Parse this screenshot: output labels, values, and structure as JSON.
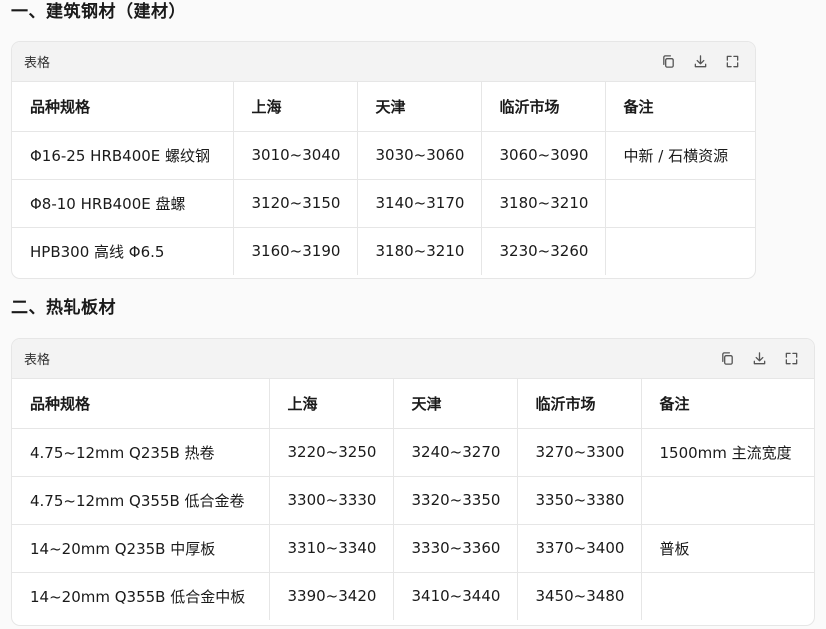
{
  "sections": [
    {
      "title": "一、建筑钢材（建材）",
      "card_label": "表格",
      "headers": [
        "品种规格",
        "上海",
        "天津",
        "临沂市场",
        "备注"
      ],
      "rows": [
        [
          "Φ16-25 HRB400E 螺纹钢",
          "3010~3040",
          "3030~3060",
          "3060~3090",
          "中新 / 石横资源"
        ],
        [
          "Φ8-10 HRB400E 盘螺",
          "3120~3150",
          "3140~3170",
          "3180~3210",
          ""
        ],
        [
          "HPB300 高线 Φ6.5",
          "3160~3190",
          "3180~3210",
          "3230~3260",
          ""
        ]
      ]
    },
    {
      "title": "二、热轧板材",
      "card_label": "表格",
      "headers": [
        "品种规格",
        "上海",
        "天津",
        "临沂市场",
        "备注"
      ],
      "rows": [
        [
          "4.75~12mm Q235B 热卷",
          "3220~3250",
          "3240~3270",
          "3270~3300",
          "1500mm 主流宽度"
        ],
        [
          "4.75~12mm Q355B 低合金卷",
          "3300~3330",
          "3320~3350",
          "3350~3380",
          ""
        ],
        [
          "14~20mm Q235B 中厚板",
          "3310~3340",
          "3330~3360",
          "3370~3400",
          "普板"
        ],
        [
          "14~20mm Q355B 低合金中板",
          "3390~3420",
          "3410~3440",
          "3450~3480",
          ""
        ]
      ]
    }
  ],
  "tool_icons": [
    "copy-icon",
    "download-icon",
    "expand-icon"
  ]
}
